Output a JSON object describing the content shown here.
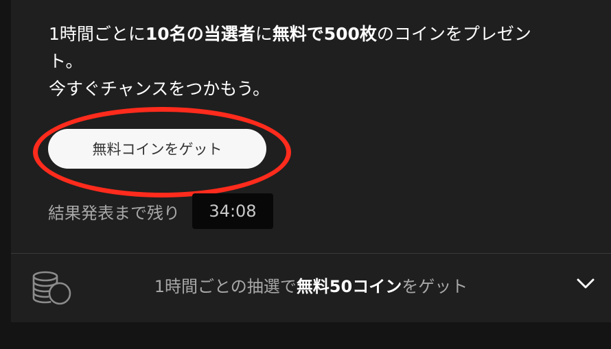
{
  "promo": {
    "p1": "1時間ごとに",
    "b1": "10名の当選者",
    "p2": "に",
    "b2": "無料で500枚",
    "p3": "のコインをプレゼン",
    "p4": "ト。",
    "line2": "今すぐチャンスをつかもう。"
  },
  "cta": {
    "label": "無料コインをゲット"
  },
  "countdown": {
    "label": "結果発表まで残り",
    "time": "34:08"
  },
  "footer": {
    "p1": "1時間ごとの抽選で",
    "b1": "無料50コイン",
    "p2": "をゲット"
  },
  "icons": {
    "coins": "coins-icon",
    "chevron": "chevron-down-icon"
  },
  "colors": {
    "panel": "#1f1f1f",
    "background": "#141414",
    "highlight_ring": "#ff2b1c",
    "button_bg": "#f7f7f7",
    "timer_bg": "#080808",
    "muted_text": "#a8a8a8"
  }
}
